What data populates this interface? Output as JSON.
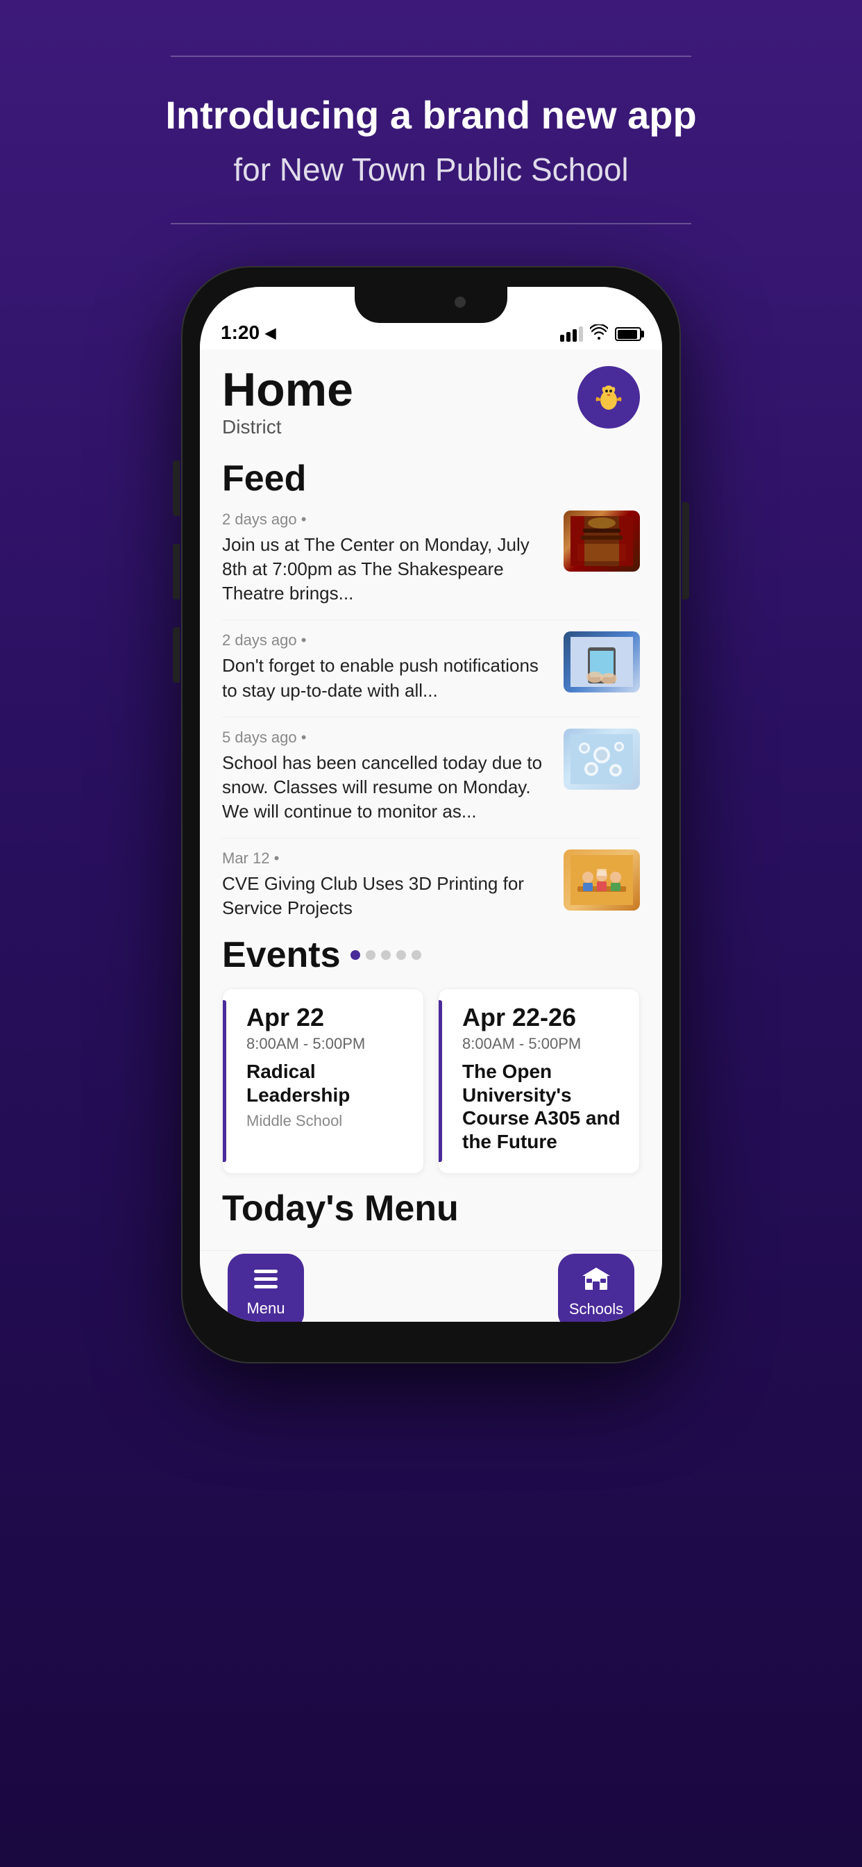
{
  "promo": {
    "divider": true,
    "title": "Introducing a brand new app",
    "subtitle": "for New Town Public School"
  },
  "phone": {
    "statusBar": {
      "time": "1:20",
      "locationIcon": "▶",
      "batteryFull": true
    },
    "header": {
      "title": "Home",
      "subtitle": "District",
      "logoEmoji": "🦅"
    },
    "feed": {
      "sectionTitle": "Feed",
      "items": [
        {
          "meta": "2 days ago",
          "body": "Join us at The Center on Monday, July 8th at 7:00pm as The Shakespeare Theatre brings...",
          "imageType": "theater"
        },
        {
          "meta": "2 days ago",
          "body": "Don't forget to enable push notifications to stay up-to-date with all...",
          "imageType": "hands"
        },
        {
          "meta": "5 days ago",
          "body": "School has been cancelled today due to snow. Classes will resume on Monday. We will continue to monitor as...",
          "imageType": "snow"
        },
        {
          "meta": "Mar 12",
          "body": "CVE Giving Club Uses 3D Printing for Service Projects",
          "imageType": "3dprint"
        }
      ]
    },
    "events": {
      "sectionTitle": "Events",
      "cards": [
        {
          "date": "Apr 22",
          "time": "8:00AM  -  5:00PM",
          "name": "Radical Leadership",
          "location": "Middle School"
        },
        {
          "date": "Apr 22-26",
          "time": "8:00AM  -  5:00PM",
          "name": "The Open University's Course A305 and the Future",
          "location": ""
        }
      ]
    },
    "todaysMenu": {
      "sectionTitle": "Today's Menu"
    },
    "bottomNav": {
      "menuLabel": "Menu",
      "schoolsLabel": "Schools"
    }
  }
}
